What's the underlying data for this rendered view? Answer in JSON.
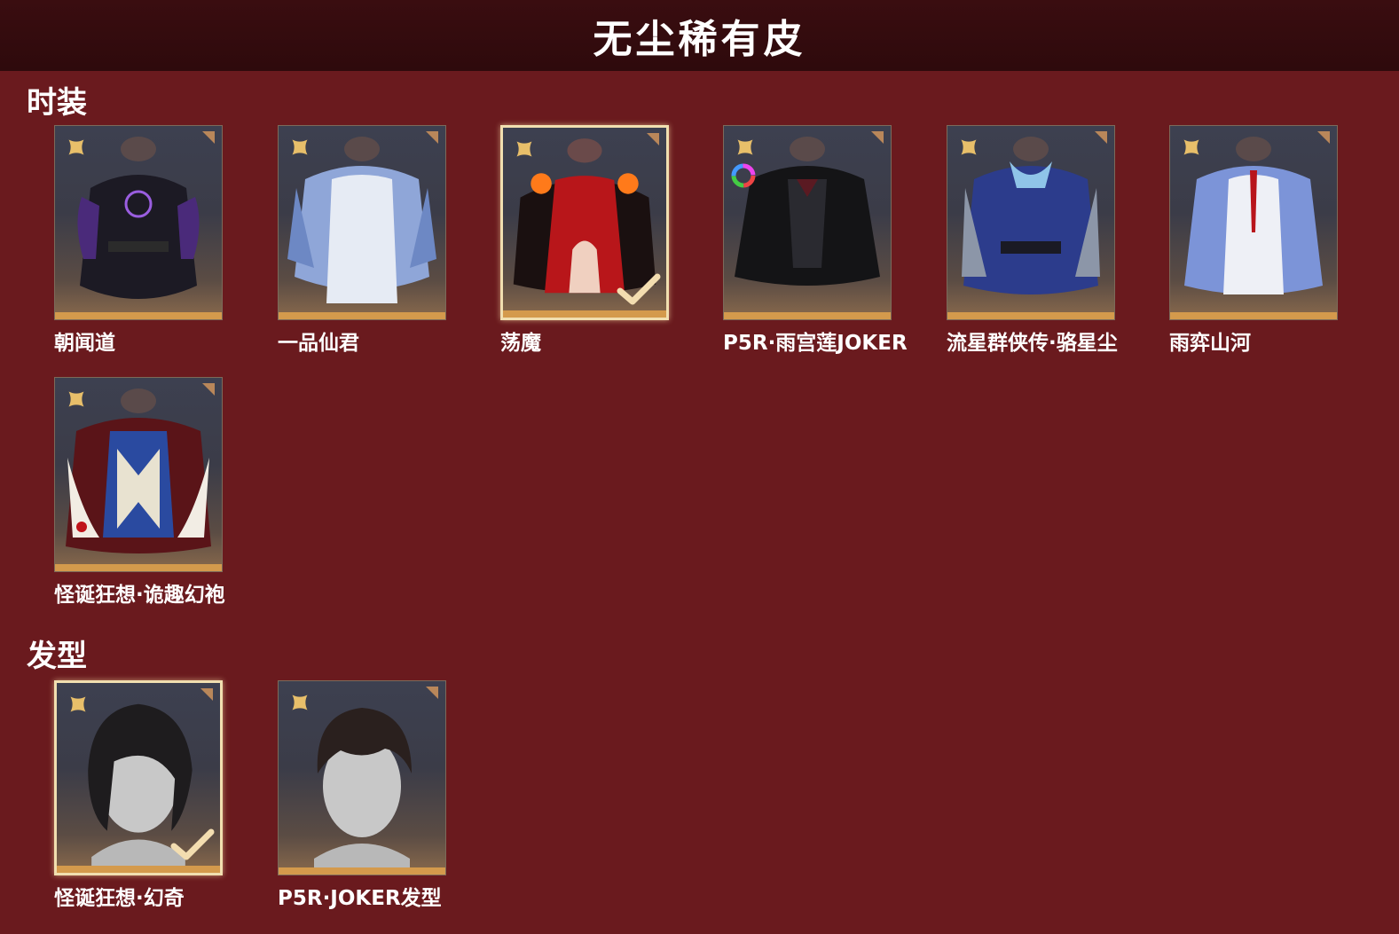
{
  "header": {
    "title": "无尘稀有皮"
  },
  "sections": {
    "outfits": {
      "heading": "时装",
      "items": [
        {
          "name": "朝闻道",
          "selected": false,
          "dye": false
        },
        {
          "name": "一品仙君",
          "selected": false,
          "dye": false
        },
        {
          "name": "荡魔",
          "selected": true,
          "dye": false
        },
        {
          "name": "P5R·雨宫莲JOKER",
          "selected": false,
          "dye": true
        },
        {
          "name": "流星群侠传·骆星尘",
          "selected": false,
          "dye": false
        },
        {
          "name": "雨弈山河",
          "selected": false,
          "dye": false
        },
        {
          "name": "怪诞狂想·诡趣幻袍",
          "selected": false,
          "dye": false
        }
      ]
    },
    "hairstyles": {
      "heading": "发型",
      "items": [
        {
          "name": "怪诞狂想·幻奇",
          "selected": true,
          "dye": false
        },
        {
          "name": "P5R·JOKER发型",
          "selected": false,
          "dye": false
        }
      ]
    }
  },
  "colors": {
    "background": "#6a1a1e",
    "header_bg": "#2e0a0c",
    "card_accent": "#d49a4c",
    "selected_border": "#f1dfb0",
    "rarity_icon": "#e8bf6a"
  },
  "icons": {
    "rarity": "four-petal-star-icon",
    "corner": "corner-tag-icon",
    "dye": "color-wheel-icon",
    "check": "checkmark-icon"
  }
}
